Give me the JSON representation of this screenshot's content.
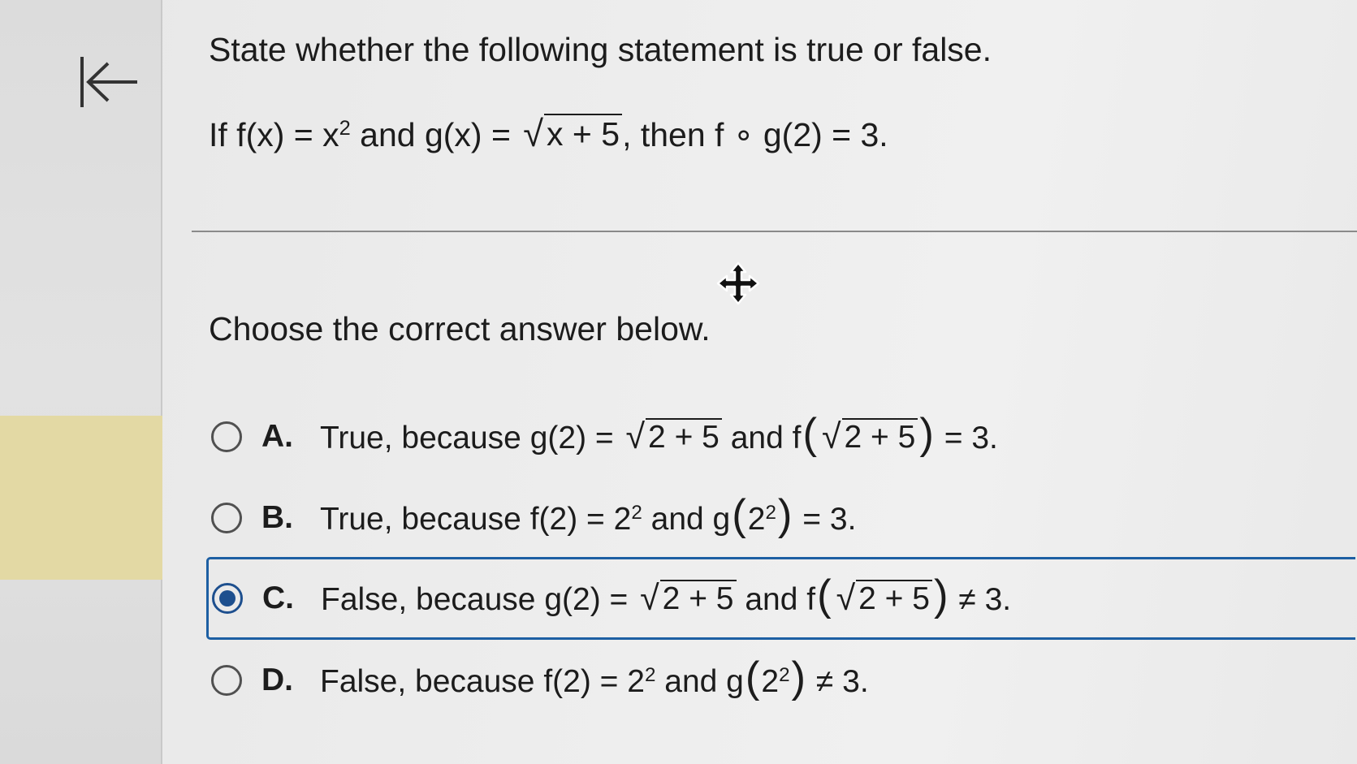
{
  "sidebar": {
    "back_icon": "first-page-arrow-icon",
    "highlight_color": "#e3d9a4"
  },
  "question": {
    "title": "State whether the following statement is true or false.",
    "statement": {
      "prefix": "If f(x) = x",
      "exp": "2",
      "middle": " and g(x) = ",
      "radicand": "x + 5",
      "suffix": ", then f ∘ g(2) = 3."
    },
    "prompt": "Choose the correct answer below."
  },
  "cursor_icon": "move-cursor-icon",
  "options": [
    {
      "letter": "A.",
      "selected": false,
      "pre": "True, because g(2) = ",
      "radicand1": "2 + 5",
      "mid": " and f",
      "radicand2": "2 + 5",
      "post": " = 3."
    },
    {
      "letter": "B.",
      "selected": false,
      "pre": "True, because f(2) = 2",
      "exp1": "2",
      "mid": " and g",
      "inner": "2",
      "exp2": "2",
      "post": " = 3."
    },
    {
      "letter": "C.",
      "selected": true,
      "pre": "False, because g(2) = ",
      "radicand1": "2 + 5",
      "mid": " and f",
      "radicand2": "2 + 5",
      "post": " ≠ 3."
    },
    {
      "letter": "D.",
      "selected": false,
      "pre": "False, because f(2) = 2",
      "exp1": "2",
      "mid": " and g",
      "inner": "2",
      "exp2": "2",
      "post": " ≠ 3."
    }
  ],
  "colors": {
    "selection_border": "#1d5fa3",
    "radio_checked": "#1d4f8e"
  }
}
